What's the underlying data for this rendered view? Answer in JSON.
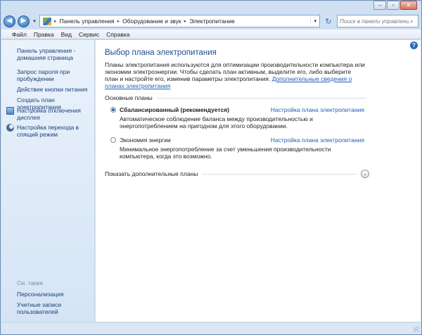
{
  "window": {
    "caption": {
      "minimize": "–",
      "maximize": "▫",
      "close": "✕"
    }
  },
  "address": {
    "crumbs": [
      "Панель управления",
      "Оборудование и звук",
      "Электропитание"
    ],
    "search_placeholder": "Поиск в панели управления"
  },
  "menu": [
    "Файл",
    "Правка",
    "Вид",
    "Сервис",
    "Справка"
  ],
  "sidebar": {
    "home": "Панель управления - домашняя страница",
    "items": [
      {
        "label": "Запрос пароля при пробуждении",
        "icon": null
      },
      {
        "label": "Действие кнопки питания",
        "icon": null
      },
      {
        "label": "Создать план электропитания",
        "icon": null
      },
      {
        "label": "Настройка отключения дисплея",
        "icon": "monitor-icon"
      },
      {
        "label": "Настройка перехода в спящий режим",
        "icon": "moon-icon"
      }
    ],
    "see_also_label": "См. также",
    "see_also": [
      "Персонализация",
      "Учетные записи пользователей"
    ]
  },
  "main": {
    "title": "Выбор плана электропитания",
    "intro": "Планы электропитания используются для оптимизации производительности компьютера или экономии электроэнергии. Чтобы сделать план активным, выделите его, либо выберите план и настройте его, изменив параметры электропитания.",
    "intro_link": "Дополнительные сведения о планах электропитания",
    "group_header": "Основные планы",
    "plans": [
      {
        "name": "Сбалансированный (рекомендуется)",
        "selected": true,
        "link": "Настройка плана электропитания",
        "description": "Автоматическое соблюдение баланса между производительностью и энергопотреблением на пригодном для этого оборудовании."
      },
      {
        "name": "Экономия энергии",
        "selected": false,
        "link": "Настройка плана электропитания",
        "description": "Минимальное энергопотребление за счет уменьшения производительности компьютера, когда это возможно."
      }
    ],
    "more_plans": "Показать дополнительные планы"
  },
  "colors": {
    "link": "#2060b8",
    "title": "#1f4c8f",
    "sidebar_link": "#1a3e7a"
  }
}
